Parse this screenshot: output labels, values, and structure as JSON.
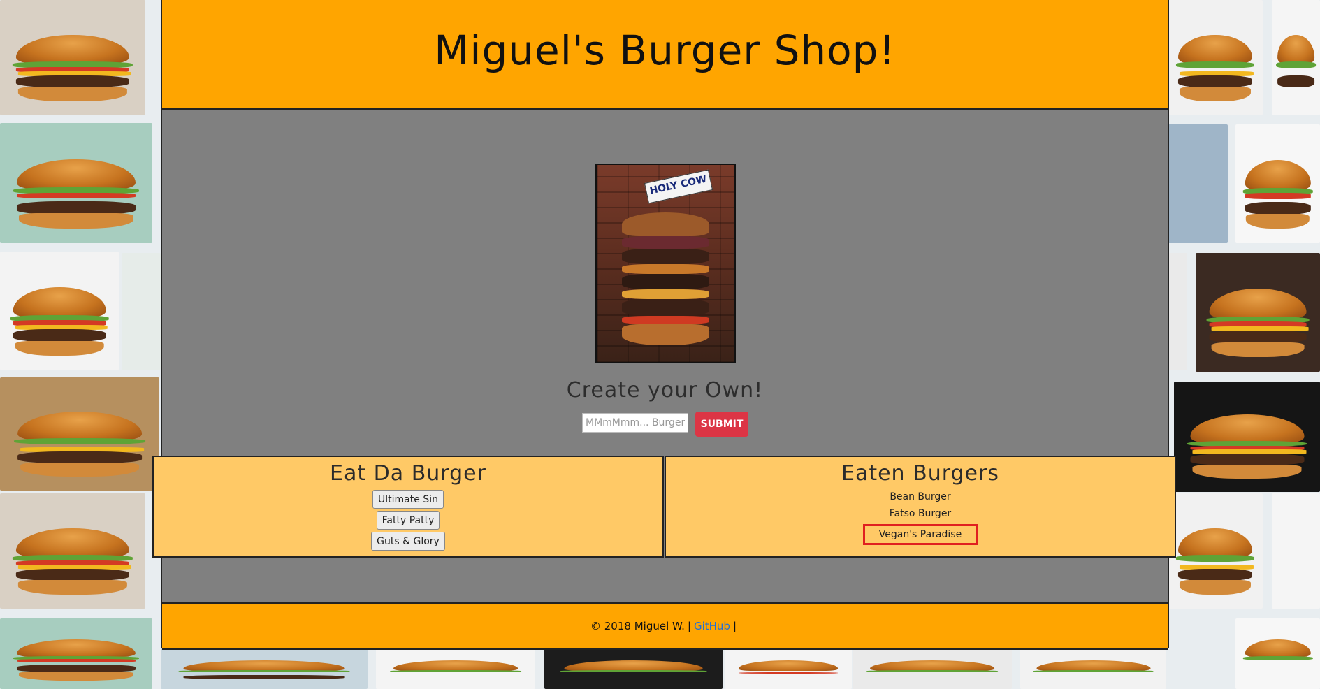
{
  "header": {
    "title": "Miguel's Burger Shop!"
  },
  "hero": {
    "flag_text": "HOLY COW"
  },
  "create": {
    "title": "Create your Own!",
    "input_placeholder": "MMmMmm... Burger",
    "submit_label": "SUBMIT"
  },
  "devour_panel": {
    "title": "Eat Da Burger",
    "burgers": [
      "Ultimate Sin",
      "Fatty Patty",
      "Guts & Glory"
    ]
  },
  "eaten_panel": {
    "title": "Eaten Burgers",
    "burgers": [
      "Bean Burger",
      "Fatso Burger",
      "Vegan's Paradise"
    ],
    "highlighted": "Vegan's Paradise"
  },
  "footer": {
    "copyright": "© 2018 Miguel W.",
    "link_label": "GitHub",
    "separator": "|"
  },
  "colors": {
    "header_bg": "#ffa500",
    "main_bg": "#808080",
    "panel_bg": "#ffc966",
    "submit_bg": "#dc3545",
    "highlight_border": "#e02020",
    "link": "#1e6fd9"
  }
}
